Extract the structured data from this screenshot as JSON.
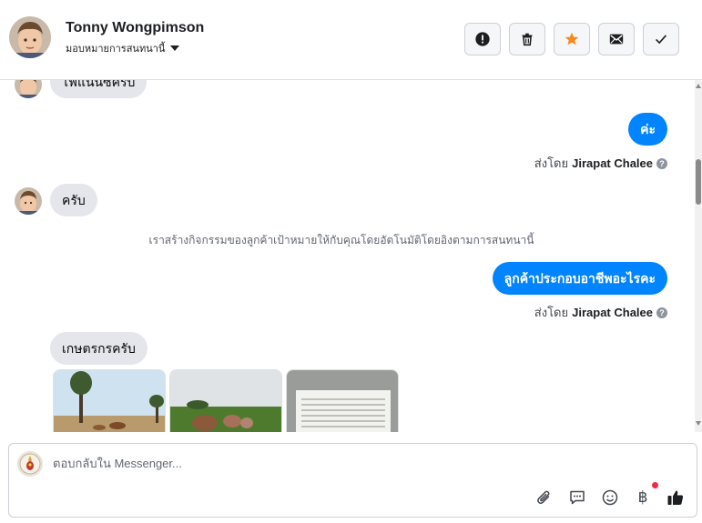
{
  "header": {
    "contact_name": "Tonny Wongpimson",
    "assign_label": "มอบหมายการสนทนานี้",
    "actions": [
      {
        "icon": "alert-icon",
        "label": "spam"
      },
      {
        "icon": "trash-icon",
        "label": "delete"
      },
      {
        "icon": "star-icon",
        "label": "star",
        "color": "#f68a1e"
      },
      {
        "icon": "mail-icon",
        "label": "unread"
      },
      {
        "icon": "check-icon",
        "label": "done"
      }
    ]
  },
  "messages": [
    {
      "direction": "in",
      "text": "ไฟแนนซ์ครับ"
    },
    {
      "direction": "out",
      "text": "ค่ะ",
      "sent_by_prefix": "ส่งโดย",
      "sent_by_name": "Jirapat Chalee"
    },
    {
      "direction": "in",
      "text": "ครับ"
    },
    {
      "direction": "system",
      "text": "เราสร้างกิจกรรมของลูกค้าเป้าหมายให้กับคุณโดยอัตโนมัติโดยอิงตามการสนทนานี้"
    },
    {
      "direction": "out",
      "text": "ลูกค้าประกอบอาชีพอะไรคะ",
      "sent_by_prefix": "ส่งโดย",
      "sent_by_name": "Jirapat Chalee"
    },
    {
      "direction": "in",
      "text": "เกษตรกรครับ"
    }
  ],
  "attachments": [
    "photo-field-palm-trees",
    "photo-cattle-grazing",
    "photo-document"
  ],
  "composer": {
    "placeholder": "ตอบกลับใน Messenger...",
    "icons": [
      "paperclip-icon",
      "saved-reply-icon",
      "emoji-icon",
      "baht-payment-icon",
      "thumbs-up-icon"
    ],
    "baht_symbol": "฿"
  },
  "colors": {
    "accent": "#0084ff",
    "incoming_bubble": "#e4e6eb",
    "star": "#f68a1e",
    "notification_dot": "#f02849"
  }
}
